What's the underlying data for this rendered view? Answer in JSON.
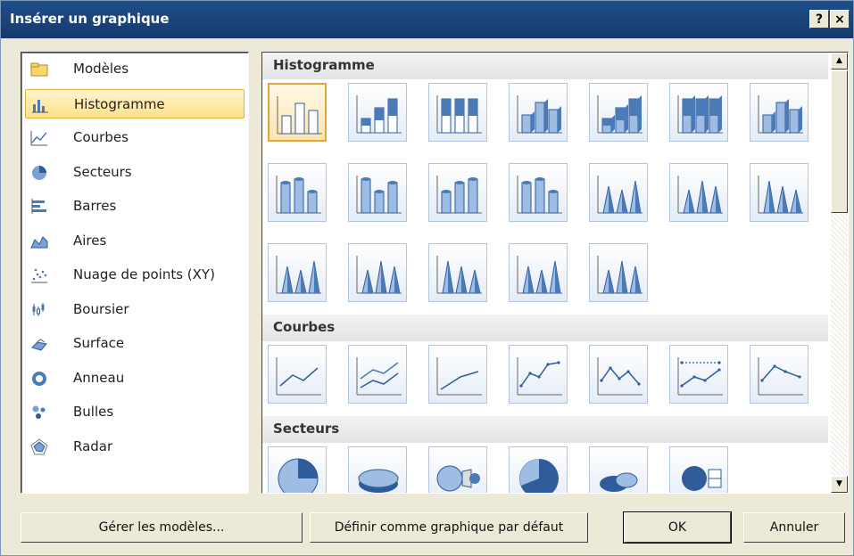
{
  "window": {
    "title": "Insérer un graphique",
    "help_label": "?",
    "close_label": "×"
  },
  "categories": [
    {
      "label": "Modèles",
      "icon": "folder-icon"
    },
    {
      "label": "Histogramme",
      "icon": "column-chart-icon",
      "selected": true
    },
    {
      "label": "Courbes",
      "icon": "line-chart-icon"
    },
    {
      "label": "Secteurs",
      "icon": "pie-chart-icon"
    },
    {
      "label": "Barres",
      "icon": "bar-chart-icon"
    },
    {
      "label": "Aires",
      "icon": "area-chart-icon"
    },
    {
      "label": "Nuage de points (XY)",
      "icon": "scatter-chart-icon"
    },
    {
      "label": "Boursier",
      "icon": "stock-chart-icon"
    },
    {
      "label": "Surface",
      "icon": "surface-chart-icon"
    },
    {
      "label": "Anneau",
      "icon": "doughnut-chart-icon"
    },
    {
      "label": "Bulles",
      "icon": "bubble-chart-icon"
    },
    {
      "label": "Radar",
      "icon": "radar-chart-icon"
    }
  ],
  "gallery": {
    "sections": [
      {
        "label": "Histogramme",
        "count": 19
      },
      {
        "label": "Courbes",
        "count": 7
      },
      {
        "label": "Secteurs",
        "count": 6
      }
    ]
  },
  "buttons": {
    "manage_templates": "Gérer les modèles...",
    "set_default": "Définir comme graphique par défaut",
    "ok": "OK",
    "cancel": "Annuler"
  },
  "colors": {
    "titlebar": "#1f4e89",
    "selection": "#fde08a",
    "accent": "#4a7ab8"
  }
}
